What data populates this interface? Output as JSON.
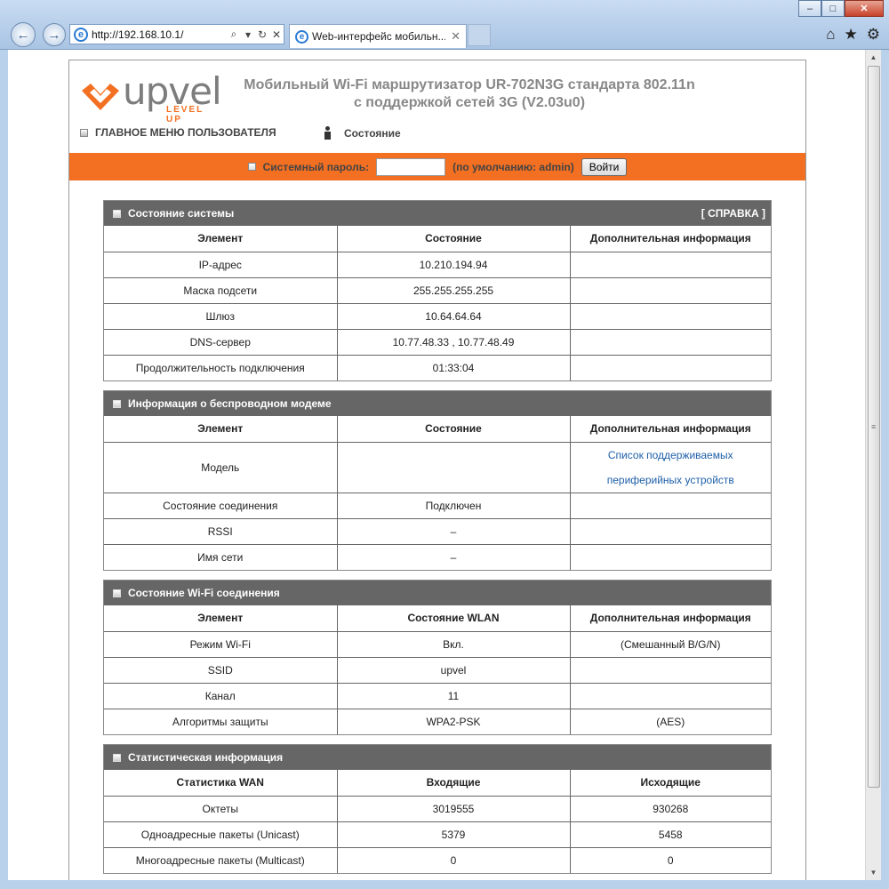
{
  "browser": {
    "address_url": "http://192.168.10.1/",
    "tab_title": "Web-интерфейс мобильн...",
    "minimize": "‒",
    "maximize": "□",
    "close": "✕"
  },
  "header": {
    "logo_word": "upvel",
    "logo_sub": "LEVEL UP",
    "title_line1": "Мобильный Wi-Fi маршрутизатор UR-702N3G стандарта 802.11n",
    "title_line2": "с поддержкой сетей 3G  (V2.03u0)",
    "main_menu": "ГЛАВНОЕ МЕНЮ ПОЛЬЗОВАТЕЛЯ",
    "status_link": "Состояние"
  },
  "login": {
    "label": "Системный пароль:",
    "value": "",
    "hint": "(по умолчанию: admin)",
    "button": "Войти"
  },
  "system": {
    "title": "Состояние системы",
    "help": "[ СПРАВКА ]",
    "headers": [
      "Элемент",
      "Состояние",
      "Дополнительная информация"
    ],
    "rows": [
      [
        "IP-адрес",
        "10.210.194.94",
        ""
      ],
      [
        "Маска подсети",
        "255.255.255.255",
        ""
      ],
      [
        "Шлюз",
        "10.64.64.64",
        ""
      ],
      [
        "DNS-сервер",
        "10.77.48.33 , 10.77.48.49",
        ""
      ],
      [
        "Продолжительность подключения",
        "01:33:04",
        ""
      ]
    ]
  },
  "modem": {
    "title": "Информация о беспроводном модеме",
    "headers": [
      "Элемент",
      "Состояние",
      "Дополнительная информация"
    ],
    "model_label": "Модель",
    "model_value": "",
    "model_link1": "Список поддерживаемых",
    "model_link2": "периферийных устройств",
    "rows": [
      [
        "Состояние соединения",
        "Подключен",
        ""
      ],
      [
        "RSSI",
        "–",
        ""
      ],
      [
        "Имя сети",
        "–",
        ""
      ]
    ]
  },
  "wifi": {
    "title": "Состояние Wi-Fi соединения",
    "headers": [
      "Элемент",
      "Состояние WLAN",
      "Дополнительная информация"
    ],
    "rows": [
      [
        "Режим Wi-Fi",
        "Вкл.",
        "(Смешанный B/G/N)"
      ],
      [
        "SSID",
        "upvel",
        ""
      ],
      [
        "Канал",
        "11",
        ""
      ],
      [
        "Алгоритмы защиты",
        "WPA2-PSK",
        "(AES)"
      ]
    ]
  },
  "stats": {
    "title": "Статистическая информация",
    "headers": [
      "Статистика WAN",
      "Входящие",
      "Исходящие"
    ],
    "rows": [
      [
        "Октеты",
        "3019555",
        "930268"
      ],
      [
        "Одноадресные пакеты (Unicast)",
        "5379",
        "5458"
      ],
      [
        "Многоадресные пакеты (Multicast)",
        "0",
        "0"
      ]
    ]
  }
}
